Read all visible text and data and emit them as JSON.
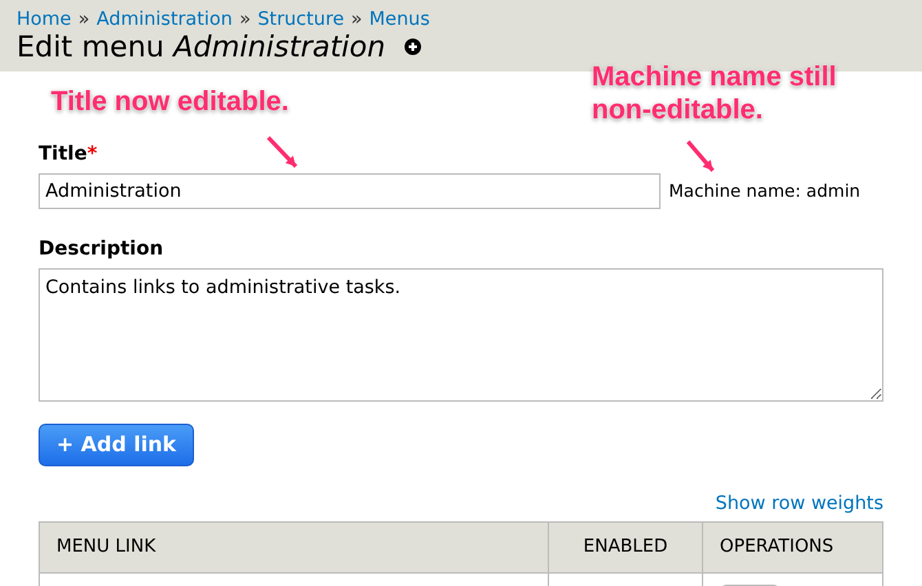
{
  "breadcrumb": [
    "Home",
    "Administration",
    "Structure",
    "Menus"
  ],
  "breadcrumb_separator": "»",
  "page_title": {
    "prefix": "Edit menu",
    "name": "Administration"
  },
  "title_field": {
    "label": "Title",
    "required_mark": "*",
    "value": "Administration",
    "machine_name": "Machine name: admin"
  },
  "description_field": {
    "label": "Description",
    "value": "Contains links to administrative tasks."
  },
  "add_button": {
    "label": "+ Add link"
  },
  "row_weights_link": "Show row weights",
  "table": {
    "columns": [
      "MENU LINK",
      "ENABLED",
      "OPERATIONS"
    ]
  },
  "annotations": [
    "Title now editable.",
    "Machine name still non-editable."
  ]
}
